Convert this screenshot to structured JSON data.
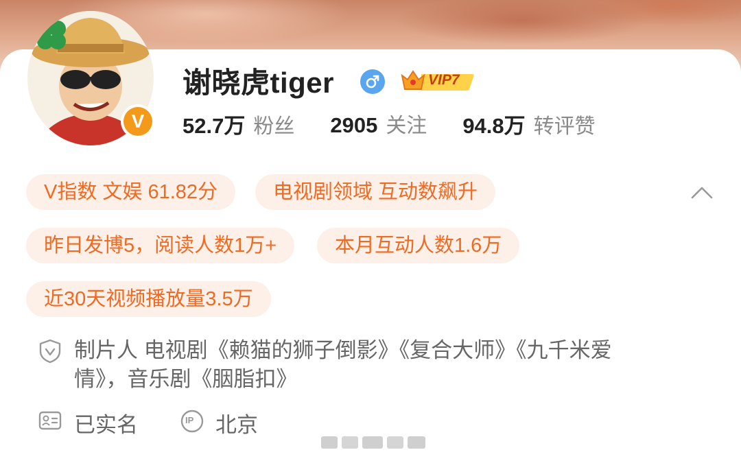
{
  "profile": {
    "name": "谢晓虎tiger",
    "vip_label": "VIP7",
    "verified_label": "V"
  },
  "stats": [
    {
      "num": "52.7万",
      "label": "粉丝"
    },
    {
      "num": "2905",
      "label": "关注"
    },
    {
      "num": "94.8万",
      "label": "转评赞"
    }
  ],
  "chips": [
    "V指数 文娱 61.82分",
    "电视剧领域 互动数飙升",
    "昨日发博5，阅读人数1万+",
    "本月互动人数1.6万",
    "近30天视频播放量3.5万"
  ],
  "bio": {
    "line1": "制片人 电视剧《赖猫的狮子倒影》《复合大师》《九千米爱",
    "line2": "情》，音乐剧《胭脂扣》"
  },
  "real_name_label": "已实名",
  "location_label": "北京",
  "ip_icon_text": "IP",
  "colors": {
    "accent": "#f06a22",
    "chip_bg": "#fdf0e9",
    "verified": "#f39a1b",
    "male": "#5aa6ee"
  }
}
